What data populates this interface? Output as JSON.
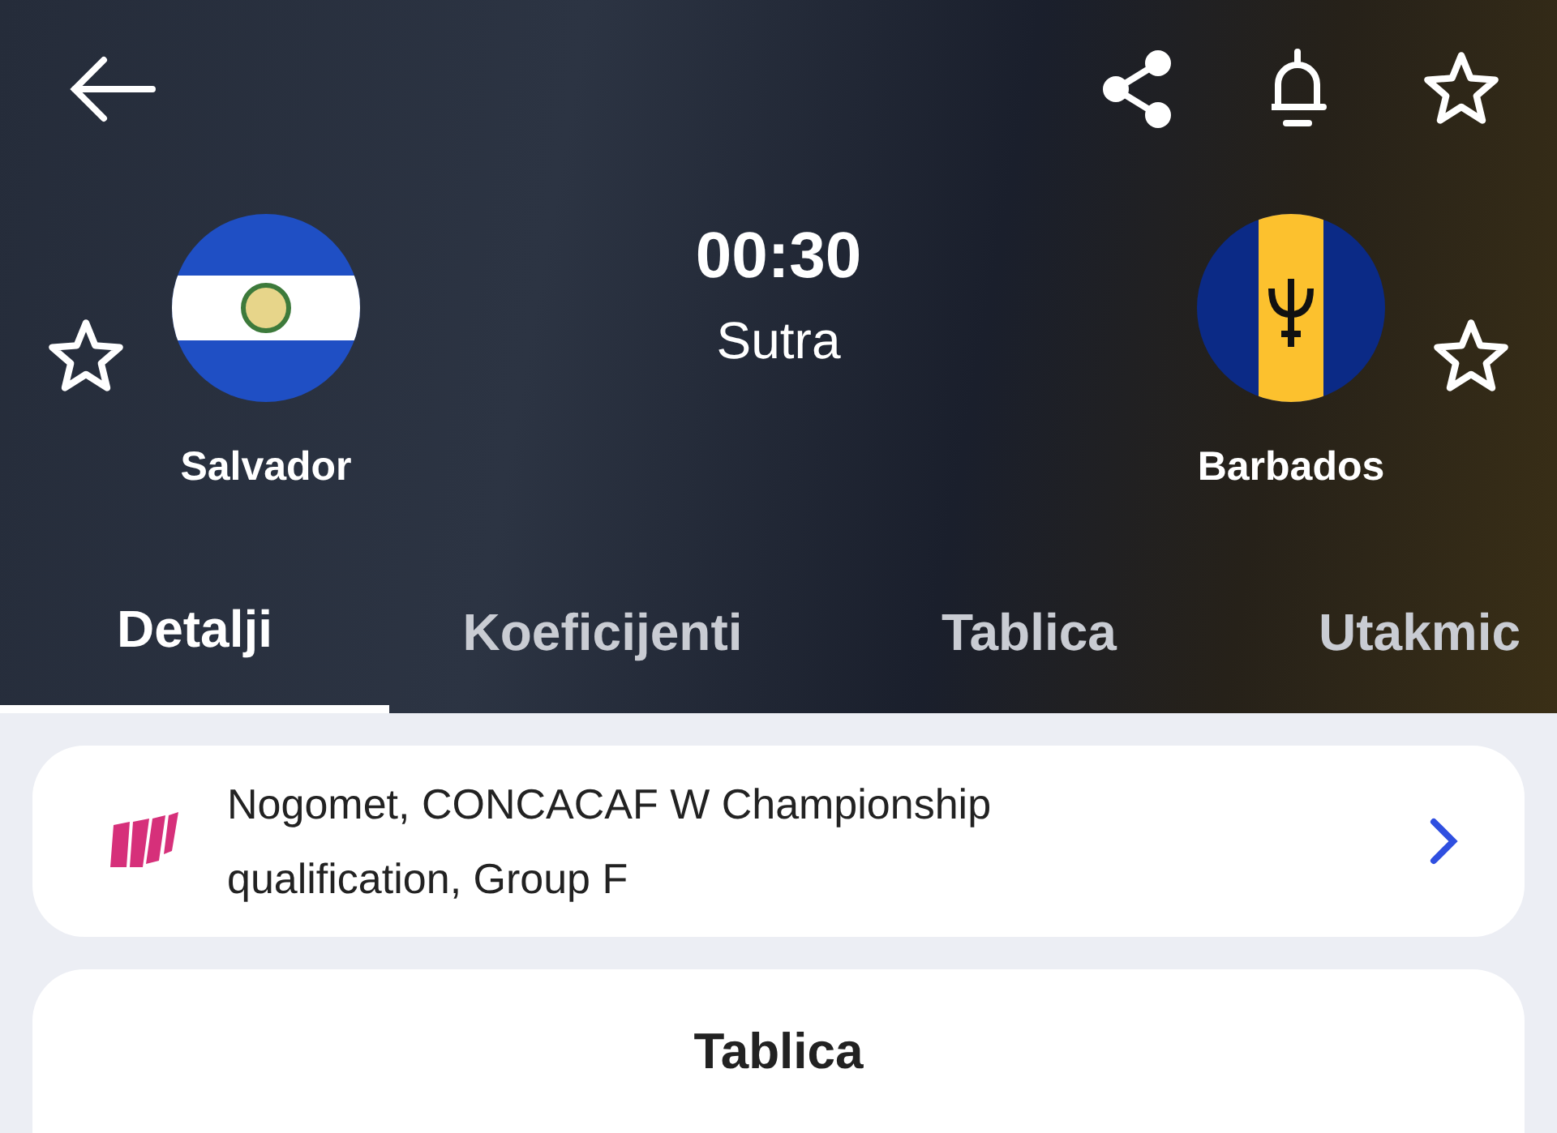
{
  "header": {
    "favorite": false
  },
  "home_team": {
    "name": "Salvador",
    "favorite": false
  },
  "away_team": {
    "name": "Barbados",
    "favorite": false
  },
  "match": {
    "time": "00:30",
    "day": "Sutra"
  },
  "tabs": [
    {
      "label": "Detalji",
      "selected": true
    },
    {
      "label": "Koeficijenti",
      "selected": false
    },
    {
      "label": "Tablica",
      "selected": false
    },
    {
      "label": "Utakmic",
      "selected": false
    }
  ],
  "competition": {
    "text": "Nogomet, CONCACAF W Championship qualification, Group F"
  },
  "standings": {
    "title": "Tablica"
  }
}
